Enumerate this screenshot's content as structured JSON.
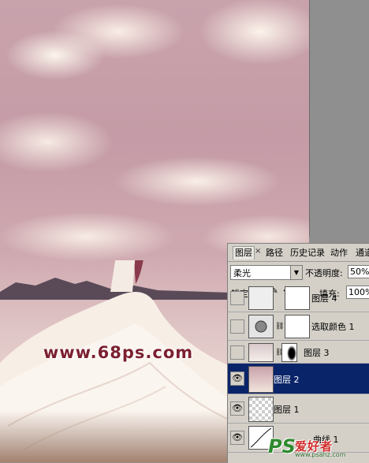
{
  "watermark": "www.68ps.com",
  "logo": {
    "ps": "PS",
    "cn": "爱好者",
    "url": "www.psahz.com"
  },
  "panel": {
    "tabs": [
      "图层",
      "路径",
      "历史记录",
      "动作",
      "通道"
    ],
    "close_glyph": "×",
    "blend_mode": "柔光",
    "opacity_label": "不透明度:",
    "opacity_value": "50%",
    "lock_label": "锁定:",
    "fill_label": "填充:",
    "fill_value": "100%",
    "layers": [
      {
        "name": "图层 4",
        "visible": false,
        "selected": false,
        "thumb": "adjust-icon"
      },
      {
        "name": "选取颜色 1",
        "visible": false,
        "selected": false,
        "thumb": "adjust-icon"
      },
      {
        "name": "图层 3",
        "visible": false,
        "selected": false,
        "thumb": "photo"
      },
      {
        "name": "图层 2",
        "visible": true,
        "selected": true,
        "thumb": "gradient"
      },
      {
        "name": "图层 1",
        "visible": true,
        "selected": false,
        "thumb": "transparent"
      },
      {
        "name": "曲线 1",
        "visible": true,
        "selected": false,
        "thumb": "curves-icon"
      }
    ]
  },
  "colors": {
    "selection": "#0a246a",
    "panel_bg": "#d4d0c8",
    "watermark": "#7c2030"
  }
}
